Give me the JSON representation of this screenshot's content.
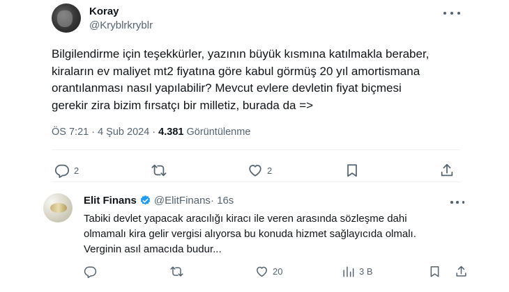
{
  "tweet": {
    "author_name": "Koray",
    "author_handle": "@Kryblrkryblr",
    "lines": [
      "Bilgilendirme için teşekkürler, yazının büyük kısmına katılmakla beraber,",
      "kiraların ev maliyet mt2 fiyatına göre kabul görmüş 20 yıl amortismana",
      "orantılanması nasıl yapılabilir? Mevcut evlere devletin fiyat biçmesi",
      "gerekir zira bizim fırsatçı bir milletiz, burada da =>"
    ],
    "time": "ÖS 7:21",
    "separator": " · ",
    "date": "4 Şub 2024",
    "views_count": "4.381",
    "views_label": " Görüntülenme",
    "actions": {
      "reply_count": "2",
      "like_count": "2"
    }
  },
  "reply": {
    "author_name": "Elit Finans",
    "author_handle": "@ElitFinans",
    "age": " · 16s",
    "lines": [
      "Tabiki devlet yapacak aracılığı kiracı ile veren arasında sözleşme dahi",
      "olmamalı kira gelir vergisi alıyorsa bu konuda hizmet sağlayıcıda olmalı.",
      "Verginin asıl amacıda budur..."
    ],
    "actions": {
      "like_count": "20",
      "views_count": "3 B"
    }
  },
  "colors": {
    "text": "#0f1419",
    "secondary": "#536471",
    "verified": "#1d9bf0",
    "divider": "#eff3f4"
  },
  "icons": [
    "more-icon",
    "reply-icon",
    "retweet-icon",
    "like-icon",
    "bookmark-icon",
    "share-icon",
    "views-icon",
    "verified-icon"
  ]
}
